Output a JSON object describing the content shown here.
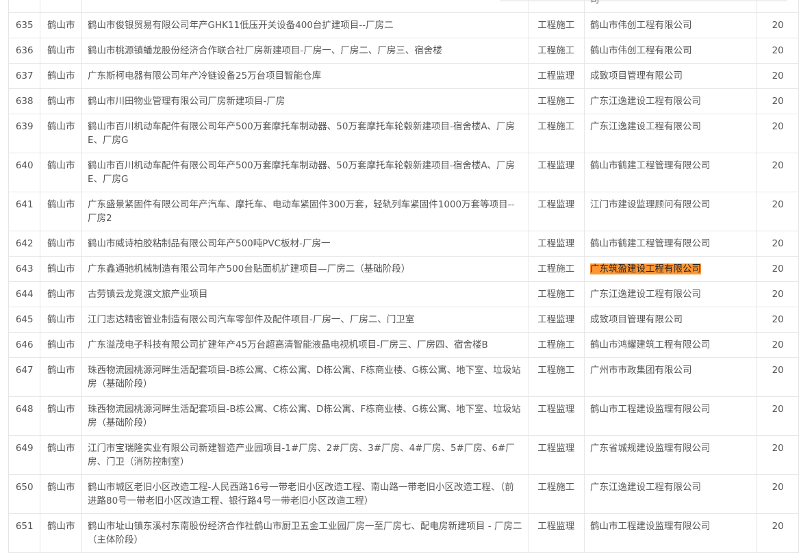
{
  "top_partial_row": {
    "index": "",
    "city": "",
    "name": "",
    "type": "",
    "unit": "司",
    "score": ""
  },
  "rows": [
    {
      "index": "635",
      "city": "鹤山市",
      "name": "鹤山市俊银贸易有限公司年产GHK11低压开关设备400台扩建项目--厂房二",
      "type": "工程施工",
      "unit": "鹤山市伟创工程有限公司",
      "score": "20",
      "lines": 1,
      "highlight": false
    },
    {
      "index": "636",
      "city": "鹤山市",
      "name": "鹤山市桃源镇蟠龙股份经济合作联合社厂房新建项目-厂房一、厂房二、厂房三、宿舍楼",
      "type": "工程施工",
      "unit": "鹤山市伟创工程有限公司",
      "score": "20",
      "lines": 1,
      "highlight": false
    },
    {
      "index": "637",
      "city": "鹤山市",
      "name": "广东斯柯电器有限公司年产冷链设备25万台项目智能仓库",
      "type": "工程监理",
      "unit": "成致项目管理有限公司",
      "score": "20",
      "lines": 1,
      "highlight": false
    },
    {
      "index": "638",
      "city": "鹤山市",
      "name": "鹤山市川田物业管理有限公司厂房新建项目-厂房",
      "type": "工程施工",
      "unit": "广东江逸建设工程有限公司",
      "score": "20",
      "lines": 1,
      "highlight": false
    },
    {
      "index": "639",
      "city": "鹤山市",
      "name": "鹤山市百川机动车配件有限公司年产500万套摩托车制动器、50万套摩托车轮毂新建项目-宿舍楼A、厂房E、厂房G",
      "type": "工程施工",
      "unit": "广东江逸建设工程有限公司",
      "score": "20",
      "lines": 2,
      "highlight": false
    },
    {
      "index": "640",
      "city": "鹤山市",
      "name": "鹤山市百川机动车配件有限公司年产500万套摩托车制动器、50万套摩托车轮毂新建项目-宿舍楼A、厂房E、厂房G",
      "type": "工程监理",
      "unit": "鹤山市鹤建工程管理有限公司",
      "score": "20",
      "lines": 2,
      "highlight": false
    },
    {
      "index": "641",
      "city": "鹤山市",
      "name": "广东盛景紧固件有限公司年产汽车、摩托车、电动车紧固件300万套，轻轨列车紧固件1000万套等项目--厂房2",
      "type": "工程监理",
      "unit": "江门市建设监理顾问有限公司",
      "score": "20",
      "lines": 2,
      "highlight": false
    },
    {
      "index": "642",
      "city": "鹤山市",
      "name": "鹤山市威诗柏胶粘制品有限公司年产500吨PVC板材-厂房一",
      "type": "工程监理",
      "unit": "鹤山市鹤建工程管理有限公司",
      "score": "20",
      "lines": 1,
      "highlight": false
    },
    {
      "index": "643",
      "city": "鹤山市",
      "name": "广东鑫通驰机械制造有限公司年产500台贴面机扩建项目—厂房二（基础阶段）",
      "type": "工程施工",
      "unit": "广东筑盈建设工程有限公司",
      "score": "20",
      "lines": 1,
      "highlight": true
    },
    {
      "index": "644",
      "city": "鹤山市",
      "name": "古劳镇云龙竞渡文旅产业项目",
      "type": "工程施工",
      "unit": "广东江逸建设工程有限公司",
      "score": "20",
      "lines": 1,
      "highlight": false
    },
    {
      "index": "645",
      "city": "鹤山市",
      "name": "江门志达精密管业制造有限公司汽车零部件及配件项目-厂房一、厂房二、门卫室",
      "type": "工程监理",
      "unit": "成致项目管理有限公司",
      "score": "20",
      "lines": 1,
      "highlight": false
    },
    {
      "index": "646",
      "city": "鹤山市",
      "name": "广东溢茂电子科技有限公司扩建年产45万台超高清智能液晶电视机项目-厂房三、厂房四、宿舍楼B",
      "type": "工程施工",
      "unit": "鹤山市鸿耀建筑工程有限公司",
      "score": "20",
      "lines": 1,
      "highlight": false
    },
    {
      "index": "647",
      "city": "鹤山市",
      "name": "珠西物流园桃源河畔生活配套项目-B栋公寓、C栋公寓、D栋公寓、F栋商业楼、G栋公寓、地下室、垃圾站房（基础阶段）",
      "type": "工程施工",
      "unit": "广州市市政集团有限公司",
      "score": "20",
      "lines": 2,
      "highlight": false
    },
    {
      "index": "648",
      "city": "鹤山市",
      "name": "珠西物流园桃源河畔生活配套项目-B栋公寓、C栋公寓、D栋公寓、F栋商业楼、G栋公寓、地下室、垃圾站房（基础阶段）",
      "type": "工程监理",
      "unit": "鹤山市工程建设监理有限公司",
      "score": "20",
      "lines": 2,
      "highlight": false
    },
    {
      "index": "649",
      "city": "鹤山市",
      "name": "江门市宝瑞隆实业有限公司新建智造产业园项目-1#厂房、2#厂房、3#厂房、4#厂房、5#厂房、6#厂房、门卫（消防控制室）",
      "type": "工程监理",
      "unit": "广东省城规建设监理有限公司",
      "score": "20",
      "lines": 2,
      "highlight": false
    },
    {
      "index": "650",
      "city": "鹤山市",
      "name": "鹤山市城区老旧小区改造工程-人民西路16号一带老旧小区改造工程、南山路一带老旧小区改造工程、（前进路80号一带老旧小区改造工程、银行路4号一带老旧小区改造工程）",
      "type": "工程施工",
      "unit": "广东江逸建设工程有限公司",
      "score": "20",
      "lines": 2,
      "highlight": false
    },
    {
      "index": "651",
      "city": "鹤山市",
      "name": "鹤山市址山镇东溪村东南股份经济合作社鹤山市厨卫五金工业园厂房一至厂房七、配电房新建项目 - 厂房二（主体阶段）",
      "type": "工程监理",
      "unit": "鹤山市工程建设监理有限公司",
      "score": "20",
      "lines": 2,
      "highlight": false
    }
  ]
}
